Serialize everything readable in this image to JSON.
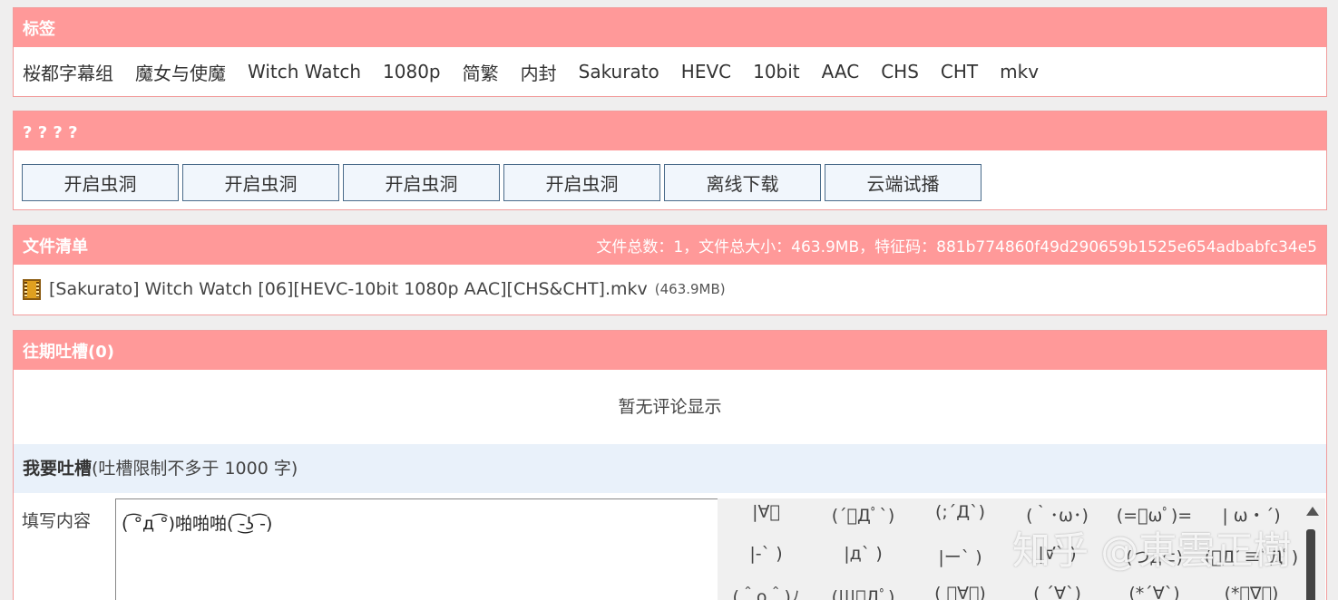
{
  "tags_panel": {
    "title": "标签",
    "tags": [
      "桜都字幕组",
      "魔女与使魔",
      "Witch Watch",
      "1080p",
      "简繁",
      "内封",
      "Sakurato",
      "HEVC",
      "10bit",
      "AAC",
      "CHS",
      "CHT",
      "mkv"
    ]
  },
  "buttons_panel": {
    "title": "? ? ? ?",
    "buttons": [
      "开启虫洞",
      "开启虫洞",
      "开启虫洞",
      "开启虫洞",
      "离线下载",
      "云端试播"
    ]
  },
  "files_panel": {
    "title": "文件清单",
    "summary": "文件总数：1，文件总大小：463.9MB，特征码：881b774860f49d290659b1525e654adbabfc34e5",
    "files": [
      {
        "name": "[Sakurato] Witch Watch [06][HEVC-10bit 1080p AAC][CHS&CHT].mkv",
        "size": "(463.9MB)",
        "icon": "film-icon"
      }
    ]
  },
  "comments_panel": {
    "title": "往期吐槽(0)",
    "empty_text": "暂无评论显示",
    "write_title": "我要吐槽",
    "write_hint": "(吐槽限制不多于 1000 字)",
    "field_label": "填写内容",
    "field_value": "( ͡°д ͡°)啪啪啪( ͡-͜ʖ ͡-)",
    "emoticons": [
      "|∀ﾟ",
      "(´ﾟДﾟ`)",
      "(;´Д`)",
      "(｀･ω･)",
      "(=ﾟωﾟ)=",
      "| ω・´)",
      "|-` )",
      "|д` )",
      "|ー` )",
      "|∀` )",
      "(つд⊂)",
      "(ﾟДﾟ≡ﾟДﾟ)",
      "(＾o＾)ﾉ",
      "(|||ﾟДﾟ)",
      "( ﾟ∀ﾟ)",
      "( ´∀`)",
      "(*´∀`)",
      "(*ﾟ∇ﾟ)"
    ]
  },
  "watermark": "知乎 @東雲正樹"
}
